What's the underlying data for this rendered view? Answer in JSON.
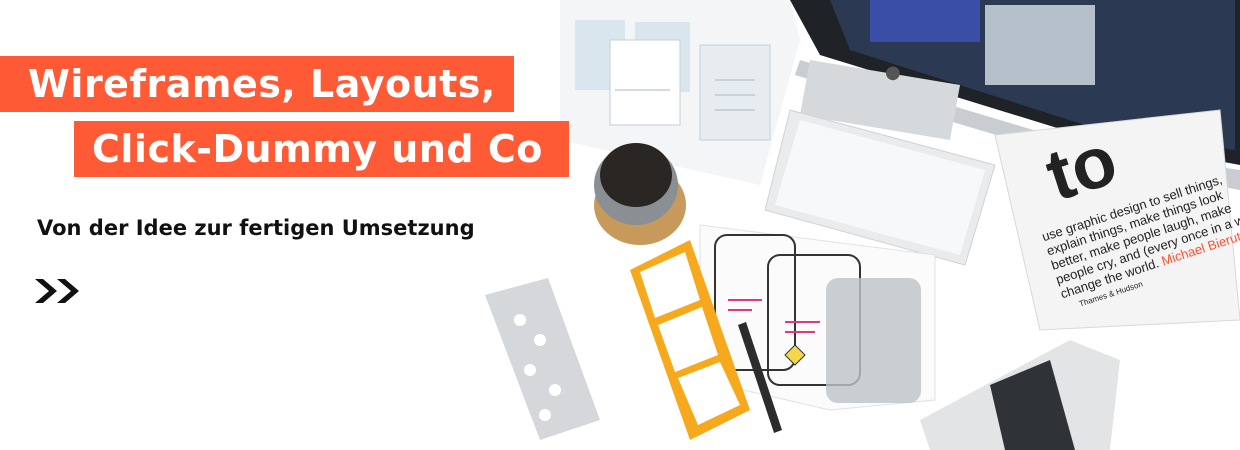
{
  "headline": {
    "line1": "Wireframes, Layouts,",
    "line2": "Click-Dummy und Co",
    "bg_color": "#ff5a36"
  },
  "subline": "Von der Idee zur fertigen Umsetzung",
  "cta": {
    "icon": "double-chevron-right-icon"
  },
  "book": {
    "title_fragment": "to",
    "body_lines": [
      "use graphic design to sell things,",
      "explain things, make things look",
      "better, make people laugh, make",
      "people cry, and (every once in a while)",
      "change the world."
    ],
    "author": "Michael Bierut",
    "publisher": "Thames & Hudson"
  }
}
